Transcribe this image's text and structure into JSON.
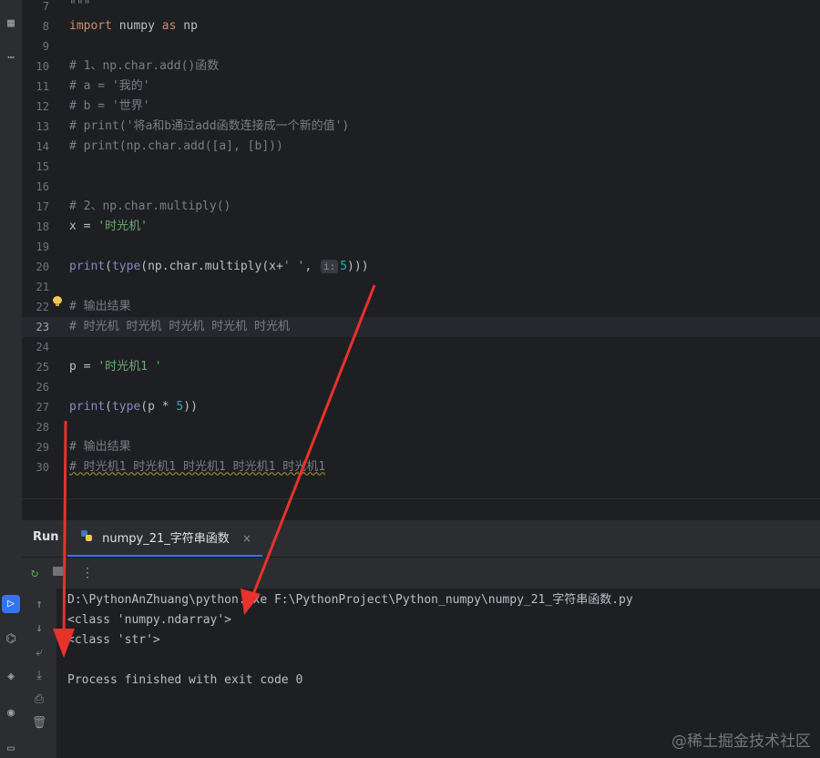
{
  "editor": {
    "current_line": "23",
    "lines": [
      {
        "n": "7",
        "tokens": [
          {
            "c": "cm",
            "t": "\"\"\""
          }
        ]
      },
      {
        "n": "8",
        "tokens": [
          {
            "c": "kw",
            "t": "import"
          },
          {
            "c": "",
            "t": " numpy "
          },
          {
            "c": "kw",
            "t": "as"
          },
          {
            "c": "",
            "t": " np"
          }
        ]
      },
      {
        "n": "9",
        "tokens": []
      },
      {
        "n": "10",
        "tokens": [
          {
            "c": "cm",
            "t": "# 1、np.char.add()函数"
          }
        ]
      },
      {
        "n": "11",
        "tokens": [
          {
            "c": "cm",
            "t": "# a = '我的'"
          }
        ]
      },
      {
        "n": "12",
        "tokens": [
          {
            "c": "cm",
            "t": "# b = '世界'"
          }
        ]
      },
      {
        "n": "13",
        "tokens": [
          {
            "c": "cm",
            "t": "# print('将a和b通过add函数连接成一个新的值')"
          }
        ]
      },
      {
        "n": "14",
        "tokens": [
          {
            "c": "cm",
            "t": "# print(np.char.add([a], [b]))"
          }
        ]
      },
      {
        "n": "15",
        "tokens": []
      },
      {
        "n": "16",
        "tokens": []
      },
      {
        "n": "17",
        "tokens": [
          {
            "c": "cm",
            "t": "# 2、np.char.multiply()"
          }
        ]
      },
      {
        "n": "18",
        "tokens": [
          {
            "c": "",
            "t": "x = "
          },
          {
            "c": "st",
            "t": "'时光机'"
          }
        ]
      },
      {
        "n": "19",
        "tokens": []
      },
      {
        "n": "20",
        "tokens": [
          {
            "c": "bi",
            "t": "print"
          },
          {
            "c": "",
            "t": "("
          },
          {
            "c": "bi",
            "t": "type"
          },
          {
            "c": "",
            "t": "(np.char.multiply(x+"
          },
          {
            "c": "st",
            "t": "' '"
          },
          {
            "c": "",
            "t": ", "
          },
          {
            "c": "hint",
            "t": "i:"
          },
          {
            "c": "nm",
            "t": "5"
          },
          {
            "c": "",
            "t": ")))"
          }
        ]
      },
      {
        "n": "21",
        "tokens": []
      },
      {
        "n": "22",
        "tokens": [
          {
            "c": "cm",
            "t": "# 输出结果"
          }
        ]
      },
      {
        "n": "23",
        "tokens": [
          {
            "c": "cm",
            "t": "# 时光机 时光机 时光机 时光机 时光机"
          }
        ]
      },
      {
        "n": "24",
        "tokens": []
      },
      {
        "n": "25",
        "tokens": [
          {
            "c": "",
            "t": "p = "
          },
          {
            "c": "st",
            "t": "'时光机1 '"
          }
        ]
      },
      {
        "n": "26",
        "tokens": []
      },
      {
        "n": "27",
        "tokens": [
          {
            "c": "bi",
            "t": "print"
          },
          {
            "c": "",
            "t": "("
          },
          {
            "c": "bi",
            "t": "type"
          },
          {
            "c": "",
            "t": "(p * "
          },
          {
            "c": "nm",
            "t": "5"
          },
          {
            "c": "",
            "t": "))"
          }
        ]
      },
      {
        "n": "28",
        "tokens": []
      },
      {
        "n": "29",
        "tokens": [
          {
            "c": "cm",
            "t": "# 输出结果"
          }
        ]
      },
      {
        "n": "30",
        "tokens": [
          {
            "c": "cm squiggle",
            "t": "# 时光机1 时光机1 时光机1 时光机1 时光机1"
          }
        ]
      }
    ]
  },
  "run_panel": {
    "title": "Run",
    "tab_label": "numpy_21_字符串函数",
    "tab_close": "×",
    "toolbar": {
      "rerun_icon": "rerun-icon",
      "stop_icon": "stop-icon",
      "more": "⋮"
    }
  },
  "console": {
    "lines": [
      "D:\\PythonAnZhuang\\python.exe F:\\PythonProject\\Python_numpy\\numpy_21_字符串函数.py",
      "<class 'numpy.ndarray'>",
      "<class 'str'>",
      "",
      "Process finished with exit code 0"
    ]
  },
  "watermark": "@稀土掘金技术社区",
  "colors": {
    "background": "#1e1f22",
    "panel": "#2b2d30",
    "accent": "#3574f0",
    "arrow": "#e8322c"
  }
}
